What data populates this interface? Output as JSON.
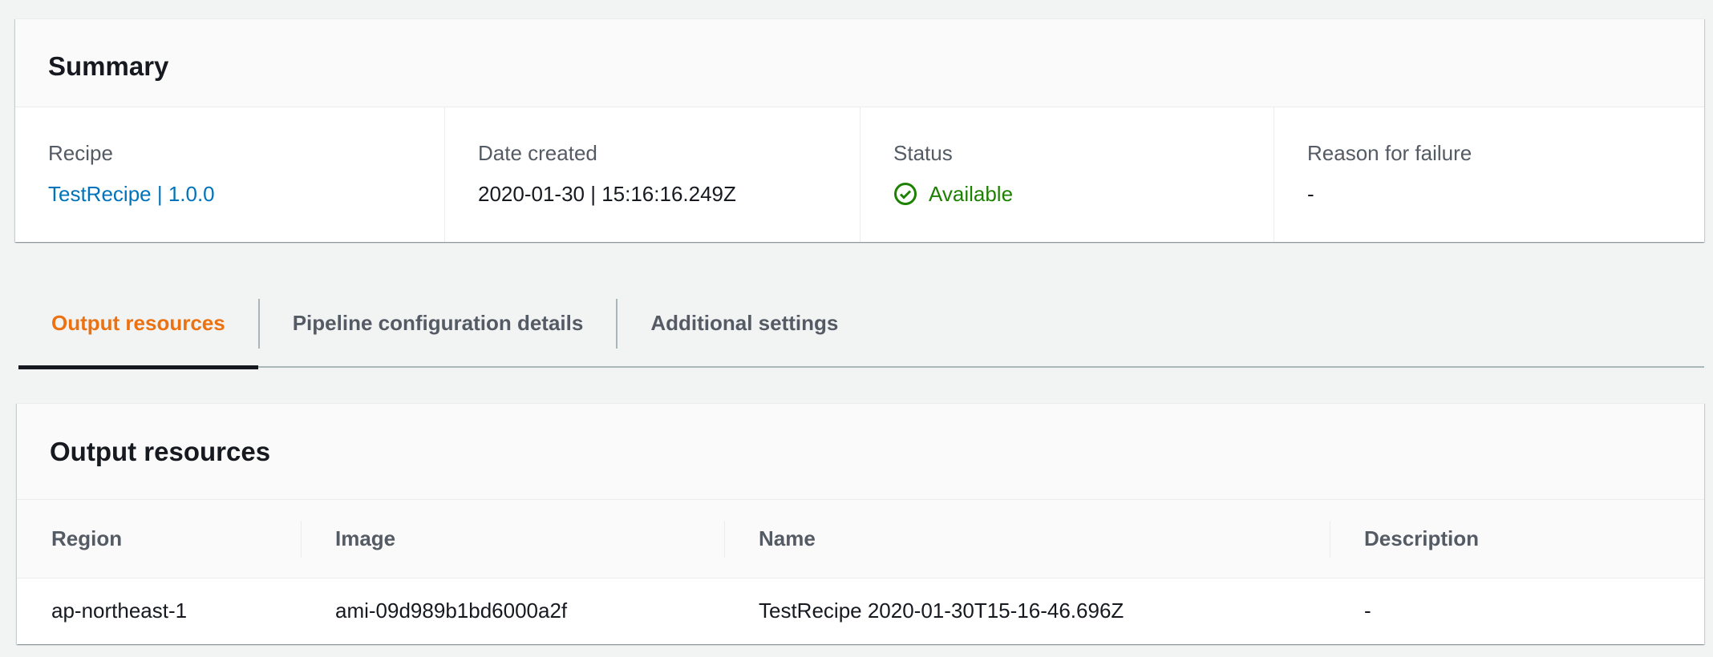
{
  "summary": {
    "title": "Summary",
    "fields": [
      {
        "label": "Recipe",
        "value": "TestRecipe | 1.0.0"
      },
      {
        "label": "Date created",
        "value": "2020-01-30 | 15:16:16.249Z"
      },
      {
        "label": "Status",
        "value": "Available",
        "icon": "check-circle-icon",
        "color": "#1d8102"
      },
      {
        "label": "Reason for failure",
        "value": "-"
      }
    ]
  },
  "tabs": [
    {
      "label": "Output resources",
      "active": true
    },
    {
      "label": "Pipeline configuration details"
    },
    {
      "label": "Additional settings"
    }
  ],
  "output": {
    "title": "Output resources",
    "columns": [
      "Region",
      "Image",
      "Name",
      "Description"
    ],
    "rows": [
      [
        "ap-northeast-1",
        "ami-09d989b1bd6000a2f",
        "TestRecipe 2020-01-30T15-16-46.696Z",
        "-"
      ]
    ]
  }
}
